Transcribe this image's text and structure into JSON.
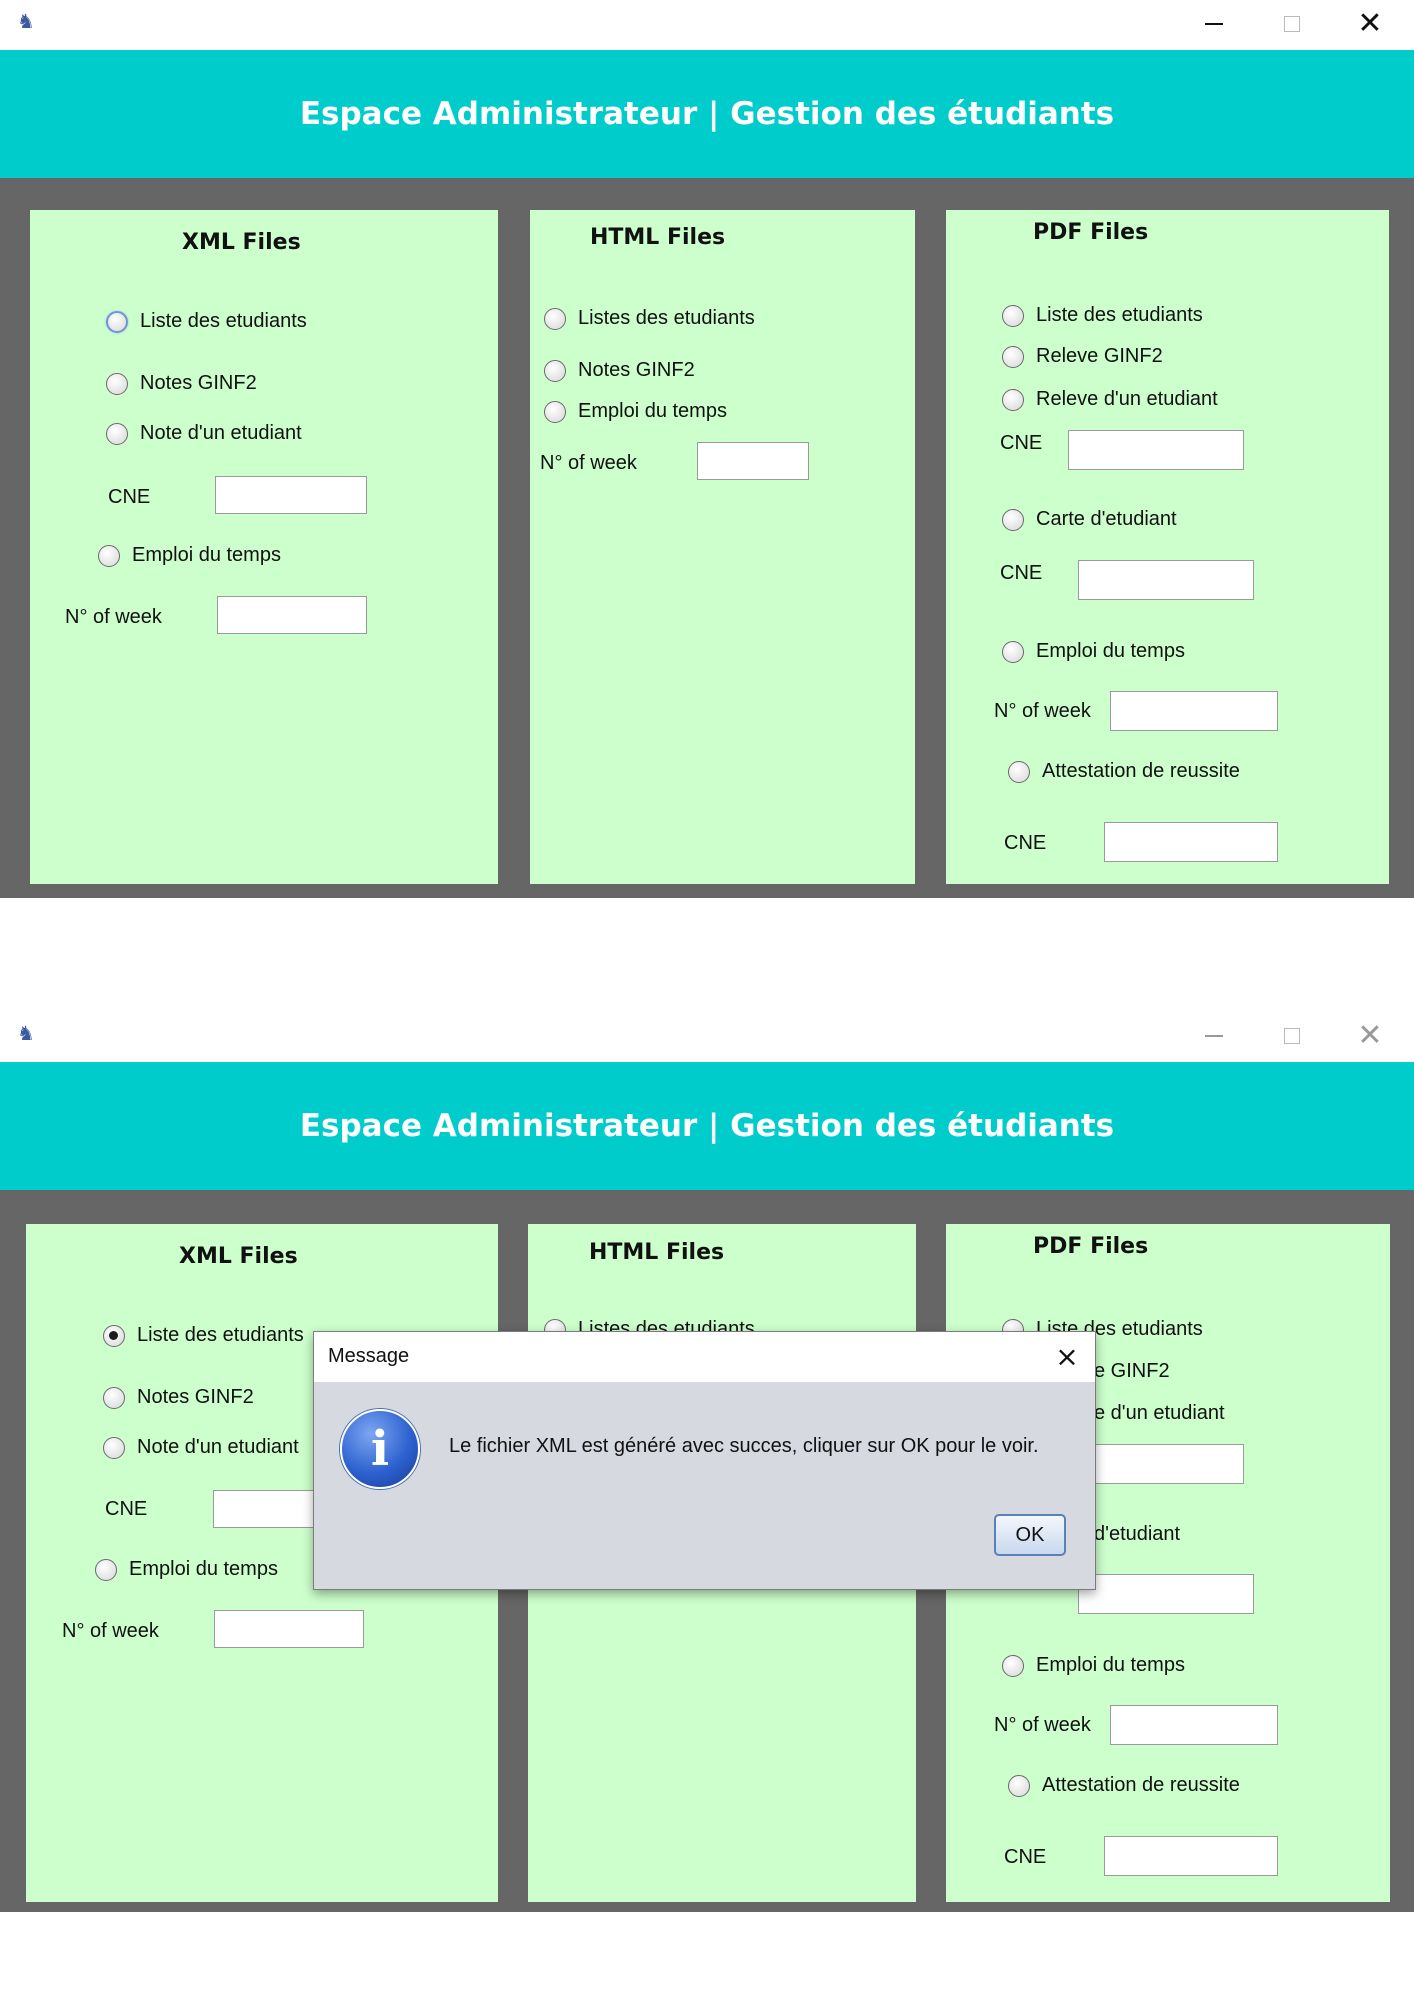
{
  "window": {
    "app_icon": "java-duke-icon",
    "controls": {
      "minimize": "minimize-icon",
      "maximize": "maximize-icon",
      "close": "close-icon"
    }
  },
  "header": {
    "title": "Espace Administrateur | Gestion des étudiants"
  },
  "colors": {
    "banner": "#00cccc",
    "background": "#666666",
    "panel": "#ccffcc",
    "dialog": "#d6d9df",
    "info_icon": "#2d62d0"
  },
  "xml_panel": {
    "title": "XML Files",
    "liste_etudiants": "Liste des etudiants",
    "notes_ginf2": "Notes GINF2",
    "note_etudiant": "Note d'un etudiant",
    "cne_label": "CNE",
    "cne_value": "",
    "emploi_du_temps": "Emploi du temps",
    "week_label": "N° of week",
    "week_value": ""
  },
  "html_panel": {
    "title": "HTML Files",
    "listes_etudiants": "Listes des etudiants",
    "notes_ginf2": "Notes GINF2",
    "emploi_du_temps": "Emploi du temps",
    "week_label": "N° of week",
    "week_value": ""
  },
  "pdf_panel": {
    "title": "PDF Files",
    "liste_etudiants": "Liste des etudiants",
    "releve_ginf2": "Releve GINF2",
    "releve_etudiant": "Releve d'un etudiant",
    "cne_label": "CNE",
    "carte_etudiant": "Carte d'etudiant",
    "emploi_du_temps": "Emploi du temps",
    "week_label": "N° of week",
    "attestation": "Attestation de reussite"
  },
  "screen2": {
    "selected_xml_option": "Liste des etudiants",
    "partial_labels": {
      "releve_ginf2": "e GINF2",
      "releve_etudiant": "e d'un etudiant",
      "carte_etudiant": "d'etudiant"
    }
  },
  "dialog": {
    "title": "Message",
    "icon": "info-icon",
    "icon_glyph": "i",
    "message": "Le fichier XML est généré avec succes, cliquer sur OK pour le voir.",
    "ok_label": "OK",
    "close_glyph": "×"
  }
}
